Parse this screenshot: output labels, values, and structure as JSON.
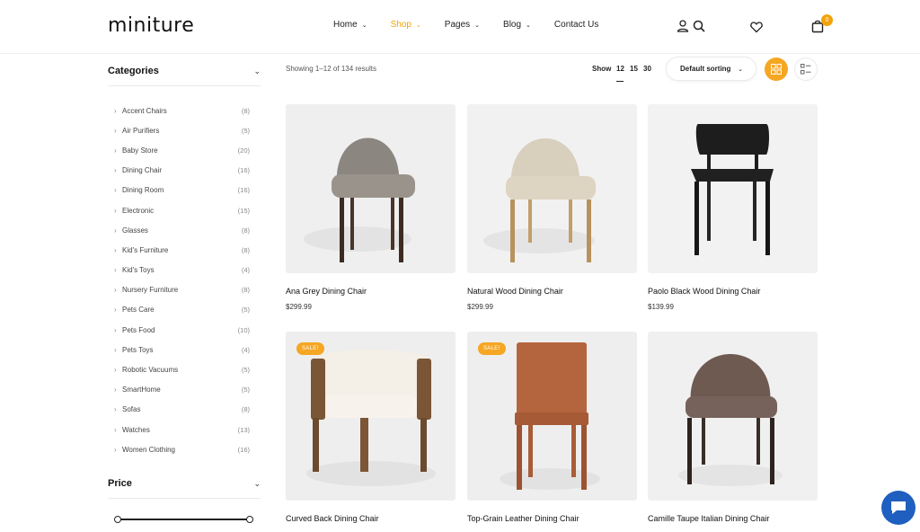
{
  "brand": {
    "logo": "miniture",
    "accent_color": "#f5a623",
    "chat_color": "#1f5fbf"
  },
  "nav": [
    {
      "label": "Home",
      "has_dropdown": true,
      "active": false
    },
    {
      "label": "Shop",
      "has_dropdown": true,
      "active": true
    },
    {
      "label": "Pages",
      "has_dropdown": true,
      "active": false
    },
    {
      "label": "Blog",
      "has_dropdown": true,
      "active": false
    },
    {
      "label": "Contact Us",
      "has_dropdown": false,
      "active": false
    }
  ],
  "header_icons": [
    "user-icon",
    "search-icon",
    "heart-icon",
    "bag-icon"
  ],
  "cart_count": "0",
  "sidebar": {
    "categories_title": "Categories",
    "categories": [
      {
        "name": "Accent Chairs",
        "count": "(8)"
      },
      {
        "name": "Air Purifiers",
        "count": "(5)"
      },
      {
        "name": "Baby Store",
        "count": "(20)"
      },
      {
        "name": "Dining Chair",
        "count": "(16)"
      },
      {
        "name": "Dining Room",
        "count": "(16)"
      },
      {
        "name": "Electronic",
        "count": "(15)"
      },
      {
        "name": "Glasses",
        "count": "(8)"
      },
      {
        "name": "Kid's Furniture",
        "count": "(8)"
      },
      {
        "name": "Kid's Toys",
        "count": "(4)"
      },
      {
        "name": "Nursery Furniture",
        "count": "(8)"
      },
      {
        "name": "Pets Care",
        "count": "(5)"
      },
      {
        "name": "Pets Food",
        "count": "(10)"
      },
      {
        "name": "Pets Toys",
        "count": "(4)"
      },
      {
        "name": "Robotic Vacuums",
        "count": "(5)"
      },
      {
        "name": "SmartHome",
        "count": "(5)"
      },
      {
        "name": "Sofas",
        "count": "(8)"
      },
      {
        "name": "Watches",
        "count": "(13)"
      },
      {
        "name": "Women Clothing",
        "count": "(16)"
      }
    ],
    "price_title": "Price"
  },
  "toolbar": {
    "results_text": "Showing 1–12 of 134 results",
    "show_label": "Show",
    "show_options": [
      "12",
      "15",
      "30"
    ],
    "show_selected": "12",
    "sort_label": "Default sorting",
    "view_modes": [
      "grid-view-icon",
      "list-view-icon"
    ],
    "active_view": "grid"
  },
  "products": [
    {
      "title": "Ana Grey Dining Chair",
      "price": "$299.99",
      "sale": false,
      "badge": ""
    },
    {
      "title": "Natural Wood Dining Chair",
      "price": "$299.99",
      "sale": false,
      "badge": ""
    },
    {
      "title": "Paolo Black Wood Dining Chair",
      "price": "$139.99",
      "sale": false,
      "badge": ""
    },
    {
      "title": "Curved Back Dining Chair",
      "price": "",
      "sale": true,
      "badge": "SALE!"
    },
    {
      "title": "Top-Grain Leather Dining Chair",
      "price": "",
      "sale": true,
      "badge": "SALE!"
    },
    {
      "title": "Camille Taupe Italian Dining Chair",
      "price": "",
      "sale": false,
      "badge": ""
    }
  ]
}
